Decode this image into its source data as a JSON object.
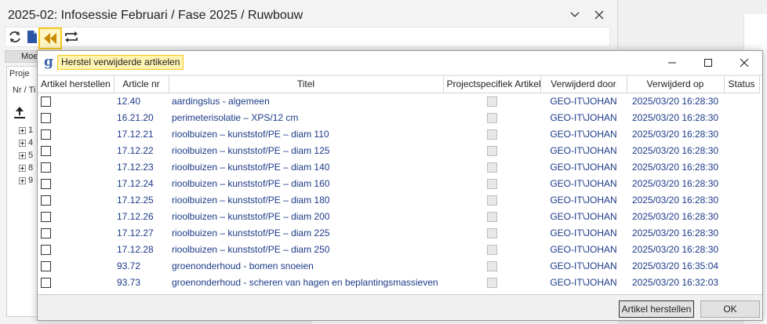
{
  "app": {
    "title": "2025-02: Infosessie Februari / Fase 2025 / Ruwbouw",
    "tab_label": "Moe",
    "panel_label": "Proje",
    "nr_label": "Nr / Ti",
    "tree_items": [
      "1",
      "4",
      "5",
      "8",
      "9"
    ]
  },
  "dialog": {
    "title": "Herstel verwijderde artikelen",
    "icon": "g-logo",
    "columns": {
      "restore": "Artikel herstellen",
      "article_nr": "Article nr",
      "title": "Titel",
      "project_specific": "Projectspecifiek Artikel",
      "deleted_by": "Verwijderd door",
      "deleted_on": "Verwijderd op",
      "status": "Status"
    },
    "rows": [
      {
        "nr": "12.40",
        "title": "aardingslus - algemeen",
        "by": "GEO-IT\\JOHAN",
        "on": "2025/03/20 16:28:30",
        "status": ""
      },
      {
        "nr": "16.21.20",
        "title": "perimeterisolatie – XPS/12 cm",
        "by": "GEO-IT\\JOHAN",
        "on": "2025/03/20 16:28:30",
        "status": ""
      },
      {
        "nr": "17.12.21",
        "title": "rioolbuizen – kunststof/PE – diam 110",
        "by": "GEO-IT\\JOHAN",
        "on": "2025/03/20 16:28:30",
        "status": ""
      },
      {
        "nr": "17.12.22",
        "title": "rioolbuizen – kunststof/PE – diam 125",
        "by": "GEO-IT\\JOHAN",
        "on": "2025/03/20 16:28:30",
        "status": ""
      },
      {
        "nr": "17.12.23",
        "title": "rioolbuizen – kunststof/PE – diam 140",
        "by": "GEO-IT\\JOHAN",
        "on": "2025/03/20 16:28:30",
        "status": ""
      },
      {
        "nr": "17.12.24",
        "title": "rioolbuizen – kunststof/PE – diam 160",
        "by": "GEO-IT\\JOHAN",
        "on": "2025/03/20 16:28:30",
        "status": ""
      },
      {
        "nr": "17.12.25",
        "title": "rioolbuizen – kunststof/PE – diam 180",
        "by": "GEO-IT\\JOHAN",
        "on": "2025/03/20 16:28:30",
        "status": ""
      },
      {
        "nr": "17.12.26",
        "title": "rioolbuizen – kunststof/PE – diam 200",
        "by": "GEO-IT\\JOHAN",
        "on": "2025/03/20 16:28:30",
        "status": ""
      },
      {
        "nr": "17.12.27",
        "title": "rioolbuizen – kunststof/PE – diam 225",
        "by": "GEO-IT\\JOHAN",
        "on": "2025/03/20 16:28:30",
        "status": ""
      },
      {
        "nr": "17.12.28",
        "title": "rioolbuizen – kunststof/PE – diam 250",
        "by": "GEO-IT\\JOHAN",
        "on": "2025/03/20 16:28:30",
        "status": ""
      },
      {
        "nr": "93.72",
        "title": "groenonderhoud - bomen snoeien",
        "by": "GEO-IT\\JOHAN",
        "on": "2025/03/20 16:35:04",
        "status": ""
      },
      {
        "nr": "93.73",
        "title": "groenonderhoud - scheren van hagen en beplantingsmassieven",
        "by": "GEO-IT\\JOHAN",
        "on": "2025/03/20 16:32:03",
        "status": ""
      }
    ],
    "buttons": {
      "restore": "Artikel herstellen",
      "ok": "OK"
    }
  },
  "colors": {
    "highlight_border": "#f4c81e",
    "highlight_fill": "#fff3b0",
    "link_text": "#1c3a88",
    "icon_blue": "#3b64a8"
  }
}
